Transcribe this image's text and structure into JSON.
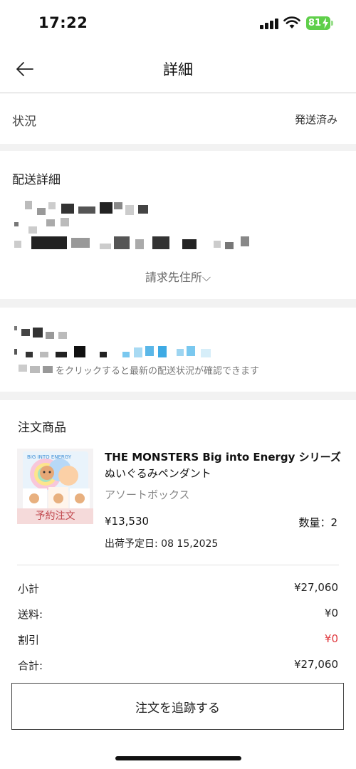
{
  "status_bar": {
    "time": "17:22",
    "battery": "81"
  },
  "header": {
    "title": "詳細"
  },
  "order_status": {
    "label": "状況",
    "value": "発送済み"
  },
  "delivery": {
    "title": "配送詳細",
    "billing_link": "請求先住所⌵"
  },
  "tracking": {
    "hint": "をクリックすると最新の配送状況が確認できます"
  },
  "order": {
    "title": "注文商品",
    "product": {
      "name_line1": "THE MONSTERS Big into Energy シリーズ",
      "name_line2": "ぬいぐるみペンダント",
      "variant": "アソートボックス",
      "badge": "予約注文",
      "price": "¥13,530",
      "quantity": "数量：2",
      "ship_date": "出荷予定日:   08 15,2025"
    },
    "summary": {
      "subtotal_label": "小計",
      "subtotal_value": "¥27,060",
      "shipping_label": "送料:",
      "shipping_value": "¥0",
      "discount_label": "割引",
      "discount_value": "¥0",
      "total_label": "合計:",
      "total_value": "¥27,060"
    },
    "track_button": "注文を追跡する"
  },
  "colors": {
    "accent_red": "#e0393f",
    "badge_bg": "#f5dada",
    "battery_green": "#5fcf4a",
    "section_gap": "#f2f2f2"
  }
}
